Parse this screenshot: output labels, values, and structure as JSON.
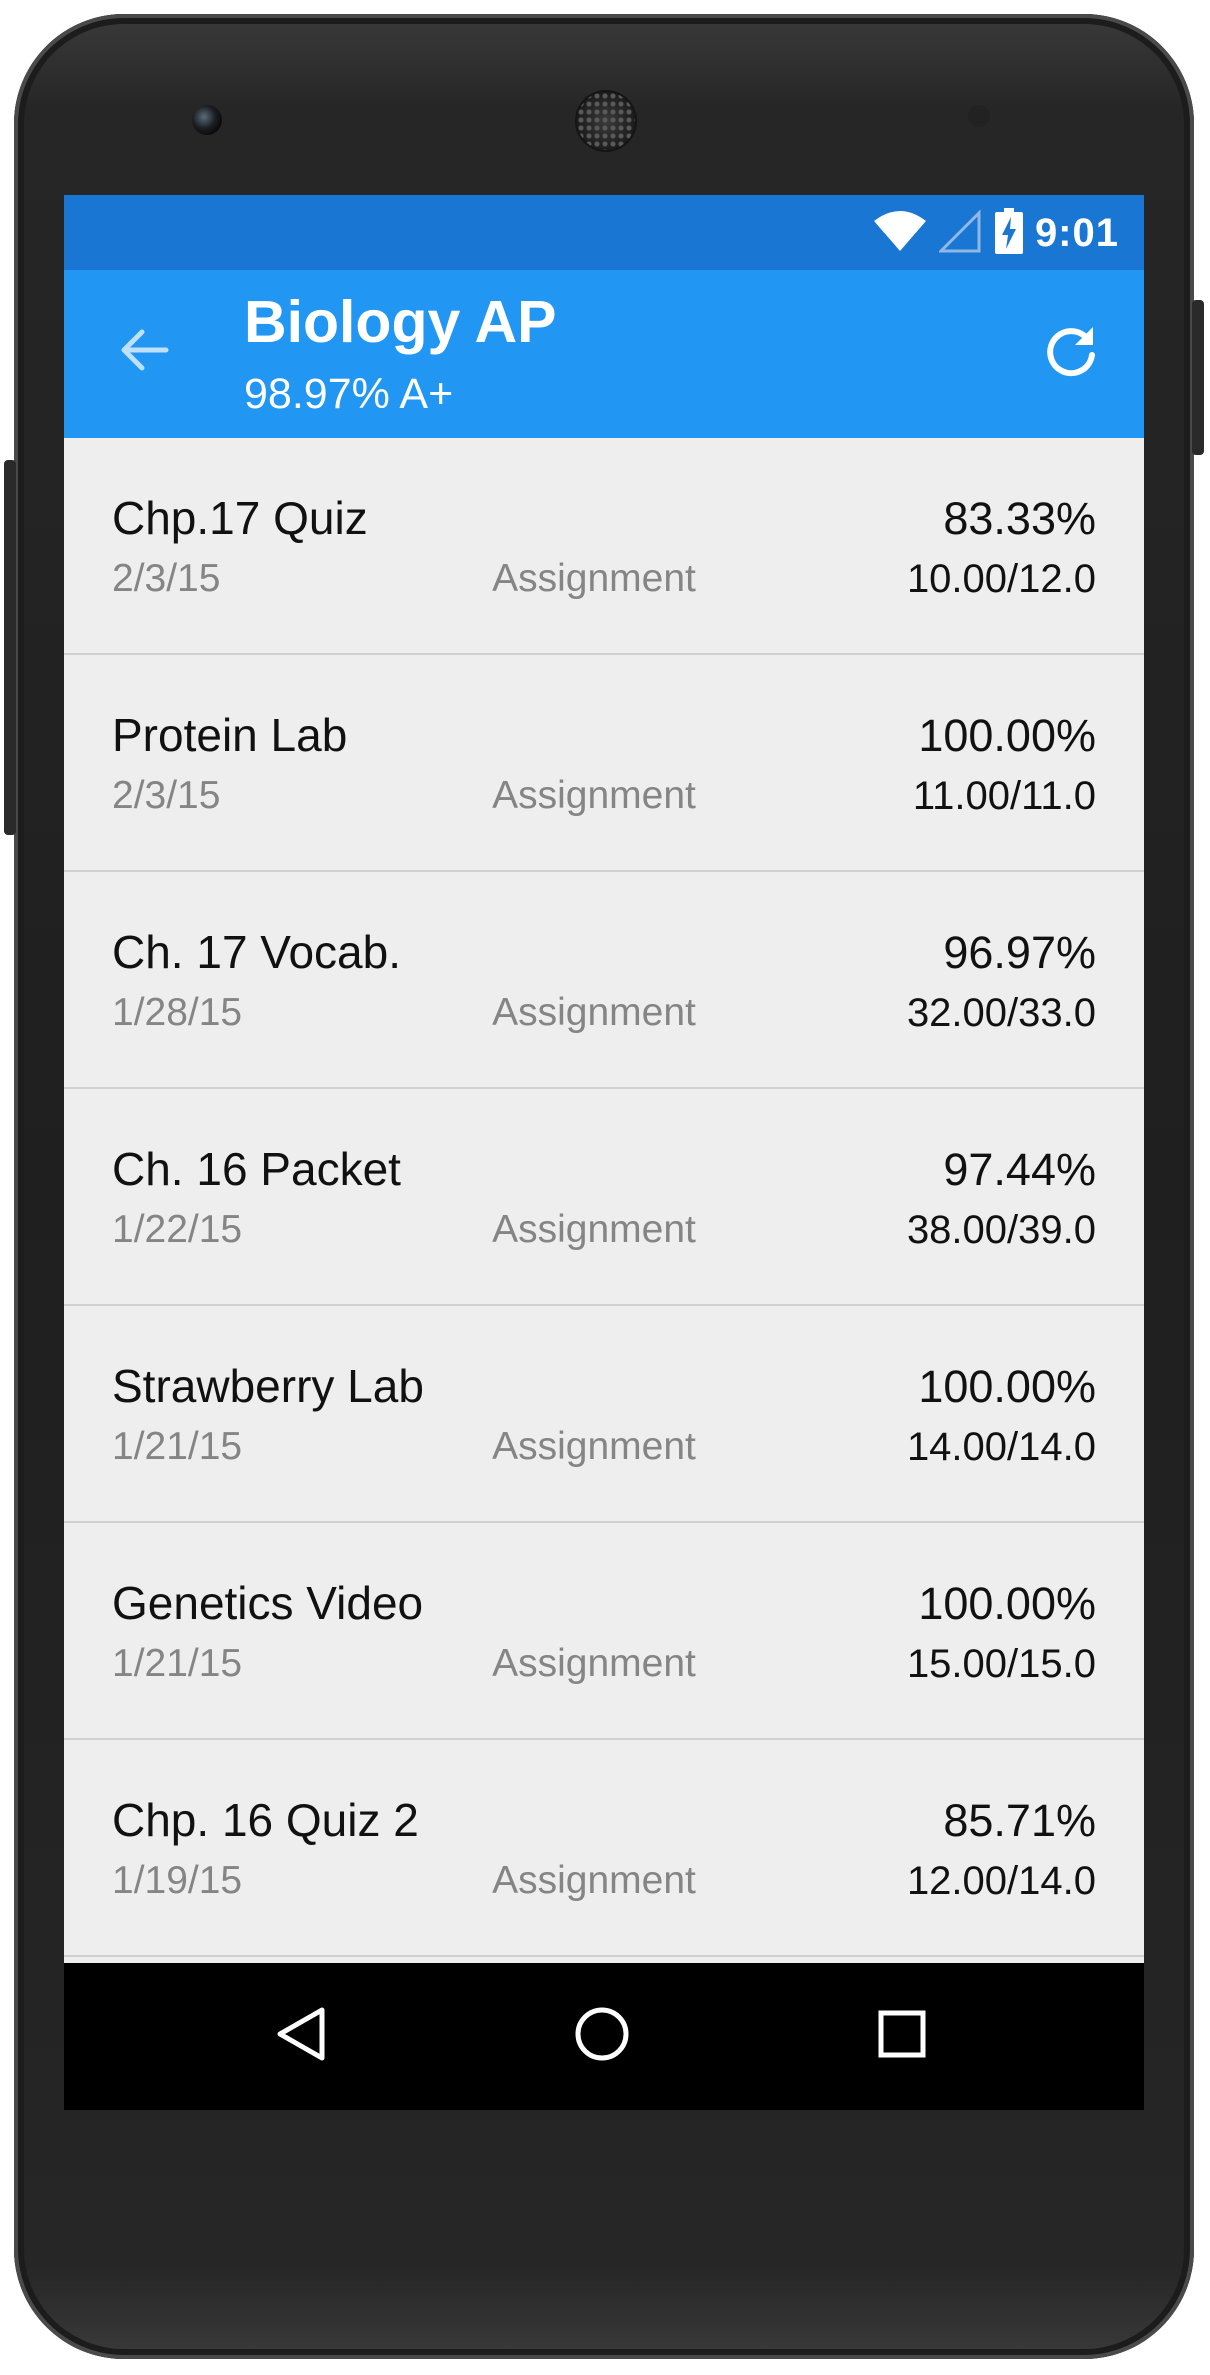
{
  "status_bar": {
    "time": "9:01",
    "icons": [
      "wifi-icon",
      "cellular-signal-icon",
      "battery-charging-icon"
    ]
  },
  "app_bar": {
    "title": "Biology AP",
    "subtitle": "98.97% A+",
    "back_icon": "arrow-back-icon",
    "refresh_icon": "refresh-icon"
  },
  "assignments": [
    {
      "name": "Chp.17 Quiz",
      "date": "2/3/15",
      "type": "Assignment",
      "percent": "83.33%",
      "score": "10.00/12.0"
    },
    {
      "name": "Protein Lab",
      "date": "2/3/15",
      "type": "Assignment",
      "percent": "100.00%",
      "score": "11.00/11.0"
    },
    {
      "name": "Ch. 17 Vocab.",
      "date": "1/28/15",
      "type": "Assignment",
      "percent": "96.97%",
      "score": "32.00/33.0"
    },
    {
      "name": "Ch. 16 Packet",
      "date": "1/22/15",
      "type": "Assignment",
      "percent": "97.44%",
      "score": "38.00/39.0"
    },
    {
      "name": "Strawberry Lab",
      "date": "1/21/15",
      "type": "Assignment",
      "percent": "100.00%",
      "score": "14.00/14.0"
    },
    {
      "name": "Genetics Video",
      "date": "1/21/15",
      "type": "Assignment",
      "percent": "100.00%",
      "score": "15.00/15.0"
    },
    {
      "name": "Chp. 16 Quiz 2",
      "date": "1/19/15",
      "type": "Assignment",
      "percent": "85.71%",
      "score": "12.00/14.0"
    }
  ],
  "nav_bar": {
    "icons": [
      "nav-back-icon",
      "nav-home-icon",
      "nav-recents-icon"
    ]
  },
  "colors": {
    "status_bar": "#1976d2",
    "app_bar": "#2196f3",
    "list_background": "#eeeeee",
    "secondary_text": "#858585"
  }
}
